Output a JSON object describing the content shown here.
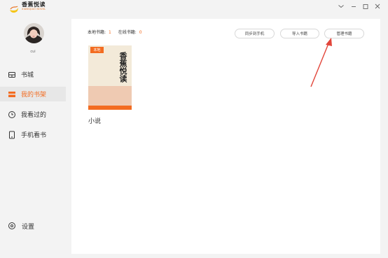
{
  "app": {
    "logo_cn": "香蕉悦读",
    "logo_en": "XIANGJIAO NOVEL"
  },
  "user": {
    "name": "cui"
  },
  "sidebar": {
    "items": [
      {
        "label": "书城",
        "icon": "store-icon",
        "active": false
      },
      {
        "label": "我的书架",
        "icon": "bookshelf-icon",
        "active": true
      },
      {
        "label": "我看过的",
        "icon": "history-clock-icon",
        "active": false
      },
      {
        "label": "手机看书",
        "icon": "phone-icon",
        "active": false
      }
    ],
    "settings_label": "设置"
  },
  "shelf": {
    "local_label": "本地书籍:",
    "local_count": "1",
    "online_label": "在线书籍:",
    "online_count": "0",
    "buttons": {
      "sync": "同步到手机",
      "import": "导入书籍",
      "manage": "管理书籍"
    },
    "books": [
      {
        "badge": "本地",
        "cover_title": "香蕉悦读",
        "name": "小说"
      }
    ]
  },
  "colors": {
    "accent": "#f36c21",
    "arrow": "#e2463b"
  }
}
